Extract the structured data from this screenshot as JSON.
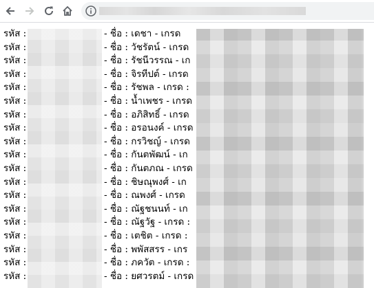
{
  "browser": {
    "back_icon": "arrow-left-icon",
    "forward_icon": "arrow-right-icon",
    "reload_icon": "reload-icon",
    "home_icon": "home-icon",
    "info_icon": "info-circle-icon"
  },
  "list": {
    "code_label": "รหัส :",
    "rows": [
      {
        "prefix": "- ชื่อ :",
        "name": "เดชา",
        "grade_label": "- เกรด"
      },
      {
        "prefix": "- ชื่อ :",
        "name": "วัชรัตน์",
        "grade_label": "- เกรด"
      },
      {
        "prefix": "- ชื่อ :",
        "name": "รัชนีวรรณ",
        "grade_label": "- เก"
      },
      {
        "prefix": "- ชื่อ :",
        "name": "จิรทีปต์",
        "grade_label": "- เกรด"
      },
      {
        "prefix": "- ชื่อ :",
        "name": "รัชพล",
        "grade_label": "- เกรด :"
      },
      {
        "prefix": "- ชื่อ :",
        "name": "น้ำเพชร",
        "grade_label": "- เกรด"
      },
      {
        "prefix": "- ชื่อ :",
        "name": "อภิสิทธิ์",
        "grade_label": "- เกรด"
      },
      {
        "prefix": "- ชื่อ :",
        "name": "อรอนงค์",
        "grade_label": "- เกรด"
      },
      {
        "prefix": "- ชื่อ :",
        "name": "กรวิชญ์",
        "grade_label": "- เกรด"
      },
      {
        "prefix": "- ชื่อ :",
        "name": "กันตพัฒน์",
        "grade_label": "- เก"
      },
      {
        "prefix": "- ชื่อ :",
        "name": "กันตภณ",
        "grade_label": "- เกรด"
      },
      {
        "prefix": "- ชื่อ :",
        "name": "ชิษณุพงศ์",
        "grade_label": "- เก"
      },
      {
        "prefix": "- ชื่อ :",
        "name": "ณพงศ์",
        "grade_label": "- เกรด"
      },
      {
        "prefix": "- ชื่อ :",
        "name": "ณัฐชนนท์",
        "grade_label": "- เก"
      },
      {
        "prefix": "- ชื่อ :",
        "name": "ณัฐวัฐ",
        "grade_label": "- เกรด :"
      },
      {
        "prefix": "- ชื่อ :",
        "name": "เตชิต",
        "grade_label": "- เกรด :"
      },
      {
        "prefix": "- ชื่อ :",
        "name": "พพัสสรร",
        "grade_label": "- เกร"
      },
      {
        "prefix": "- ชื่อ :",
        "name": "ภควัต",
        "grade_label": "- เกรด :"
      },
      {
        "prefix": "- ชื่อ :",
        "name": "ยศวรตม์",
        "grade_label": "- เกรด"
      }
    ]
  }
}
